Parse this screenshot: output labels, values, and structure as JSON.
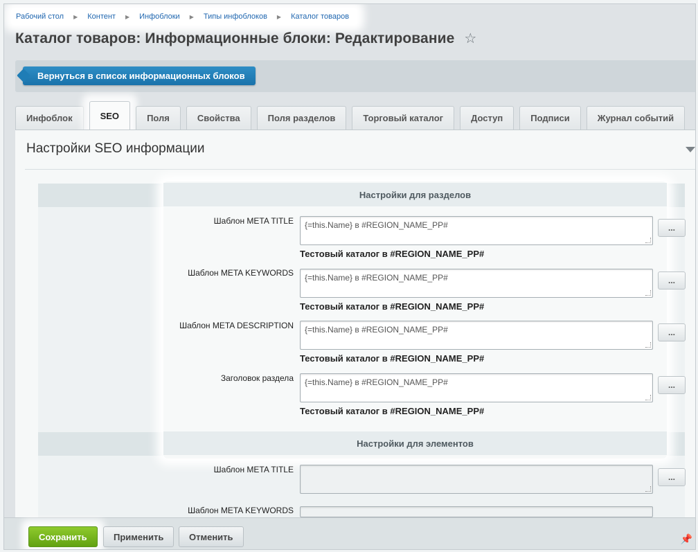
{
  "breadcrumb": [
    "Рабочий стол",
    "Контент",
    "Инфоблоки",
    "Типы инфоблоков",
    "Каталог товаров"
  ],
  "page": {
    "title": "Каталог товаров: Информационные блоки: Редактирование",
    "star_icon": "☆"
  },
  "toolbar": {
    "back_label": "Вернуться в список информационных блоков"
  },
  "tabs": [
    {
      "label": "Инфоблок"
    },
    {
      "label": "SEO"
    },
    {
      "label": "Поля"
    },
    {
      "label": "Свойства"
    },
    {
      "label": "Поля разделов"
    },
    {
      "label": "Торговый каталог"
    },
    {
      "label": "Доступ"
    },
    {
      "label": "Подписи"
    },
    {
      "label": "Журнал событий"
    }
  ],
  "active_tab": "SEO",
  "section": {
    "title": "Настройки SEO информации"
  },
  "sections_group": {
    "header": "Настройки для разделов",
    "rows": [
      {
        "label": "Шаблон META TITLE",
        "value": "{=this.Name} в #REGION_NAME_PP#",
        "preview": "Тестовый каталог в #REGION_NAME_PP#"
      },
      {
        "label": "Шаблон META KEYWORDS",
        "value": "{=this.Name} в #REGION_NAME_PP#",
        "preview": "Тестовый каталог в #REGION_NAME_PP#"
      },
      {
        "label": "Шаблон META DESCRIPTION",
        "value": "{=this.Name} в #REGION_NAME_PP#",
        "preview": "Тестовый каталог в #REGION_NAME_PP#"
      },
      {
        "label": "Заголовок раздела",
        "value": "{=this.Name} в #REGION_NAME_PP#",
        "preview": "Тестовый каталог в #REGION_NAME_PP#"
      }
    ]
  },
  "elements_group": {
    "header": "Настройки для элементов",
    "rows": [
      {
        "label": "Шаблон META TITLE",
        "value": ""
      },
      {
        "label": "Шаблон META KEYWORDS",
        "value": ""
      }
    ]
  },
  "dots_label": "...",
  "footer": {
    "save": "Сохранить",
    "apply": "Применить",
    "cancel": "Отменить"
  },
  "colors": {
    "accent_blue": "#1a73ab",
    "save_green": "#62a212",
    "link": "#2067b0"
  }
}
